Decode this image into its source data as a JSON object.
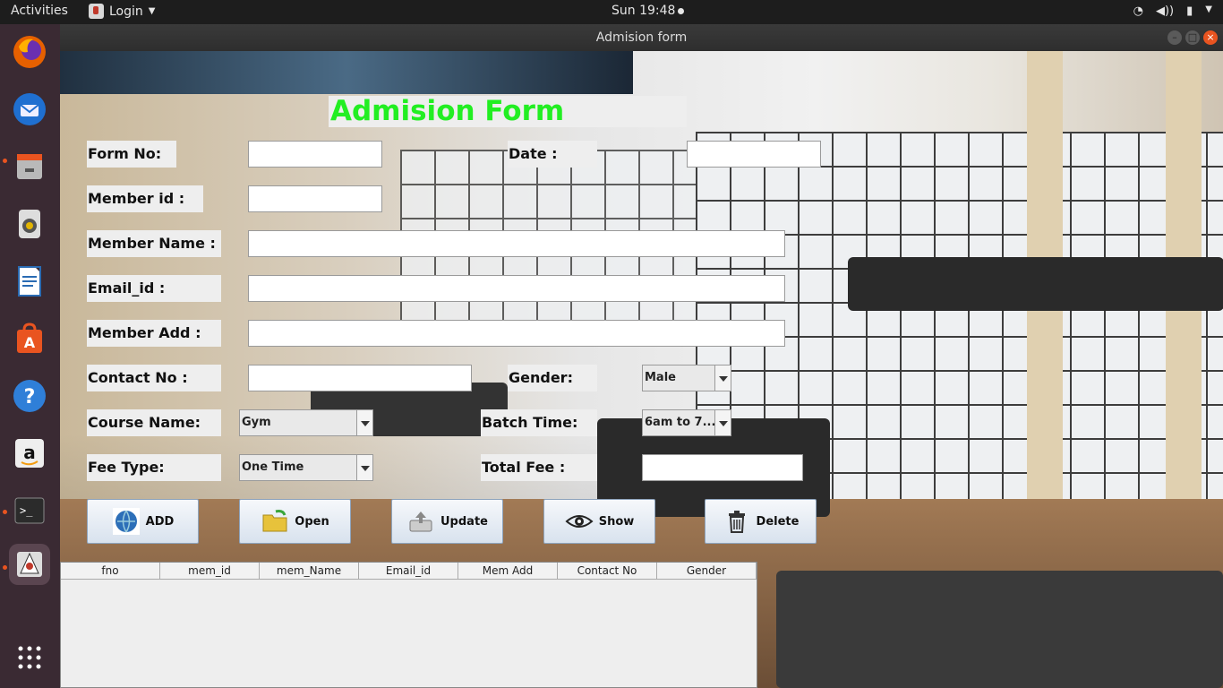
{
  "topbar": {
    "activities": "Activities",
    "app_menu": "Login",
    "clock": "Sun 19:48"
  },
  "dock": {
    "items": [
      "firefox-icon",
      "thunderbird-icon",
      "files-icon",
      "rhythmbox-icon",
      "writer-icon",
      "software-icon",
      "help-icon",
      "amazon-icon",
      "terminal-icon",
      "java-icon",
      "app-grid-icon"
    ]
  },
  "window": {
    "title": "Admision form"
  },
  "form": {
    "title": "Admision Form",
    "form_no_label": "Form No:",
    "date_label": "Date :",
    "member_id_label": "Member id :",
    "member_name_label": "Member Name :",
    "email_label": "Email_id :",
    "member_add_label": "Member Add :",
    "contact_label": "Contact No :",
    "gender_label": "Gender:",
    "gender_value": "Male",
    "course_label": "Course Name:",
    "course_value": "Gym",
    "batch_label": "Batch Time:",
    "batch_value": "6am to 7...",
    "fee_type_label": "Fee Type:",
    "fee_type_value": "One Time",
    "total_fee_label": "Total Fee :"
  },
  "buttons": {
    "add": "ADD",
    "open": "Open",
    "update": "Update",
    "show": "Show",
    "delete": "Delete"
  },
  "table": {
    "columns": [
      "fno",
      "mem_id",
      "mem_Name",
      "Email_id",
      "Mem Add",
      "Contact No",
      "Gender"
    ]
  }
}
